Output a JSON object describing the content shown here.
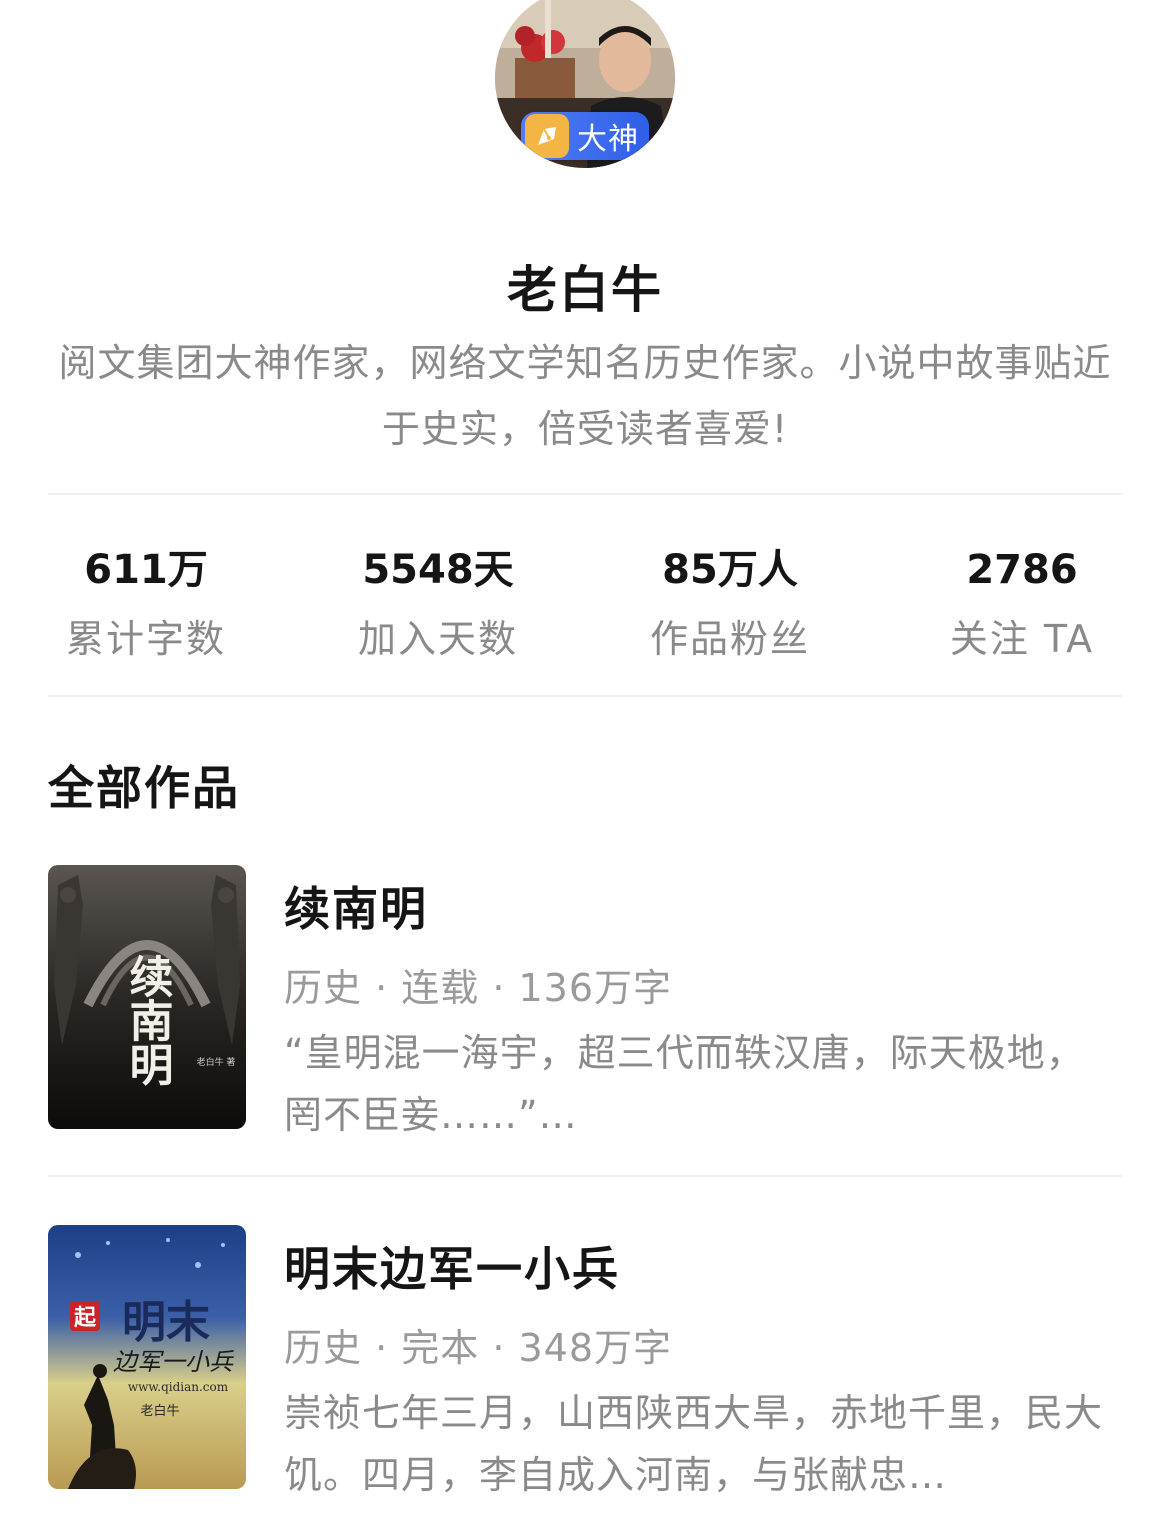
{
  "author": {
    "badge": "大神",
    "name": "老白牛",
    "bio": "阅文集团大神作家，网络文学知名历史作家。小说中故事贴近于史实，倍受读者喜爱!"
  },
  "stats": [
    {
      "value": "611万",
      "label": "累计字数"
    },
    {
      "value": "5548天",
      "label": "加入天数"
    },
    {
      "value": "85万人",
      "label": "作品粉丝"
    },
    {
      "value": "2786",
      "label": "关注 TA"
    }
  ],
  "works": {
    "section_title": "全部作品",
    "books": [
      {
        "title": "续南明",
        "meta": "历史 · 连载 · 136万字",
        "desc": "“皇明混一海宇，超三代而轶汉唐，际天极地，罔不臣妾……”…",
        "cover_title": "续南明",
        "cover_author": "老白牛 著"
      },
      {
        "title": "明末边军一小兵",
        "meta": "历史 · 完本 · 348万字",
        "desc": "崇祯七年三月，山西陕西大旱，赤地千里，民大饥。四月，李自成入河南，与张献忠…",
        "cover_badge": "起",
        "cover_title": "明末",
        "cover_subtitle": "边军一小兵",
        "cover_site": "www.qidian.com",
        "cover_author": "老白牛"
      }
    ]
  },
  "colors": {
    "badge_blue": "#2f5fe8",
    "badge_gold": "#f4b544",
    "text_primary": "#151515",
    "text_secondary": "#8a8a8a"
  }
}
